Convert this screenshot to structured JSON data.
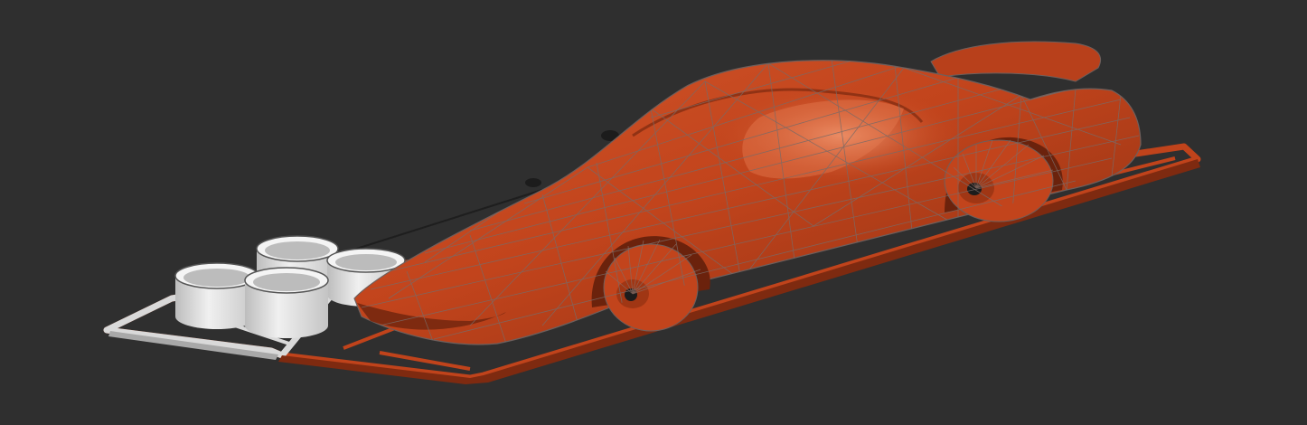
{
  "viewport": {
    "background_color": "#2f2f2f"
  },
  "scene": {
    "model": {
      "body_color": "#c2441c",
      "body_highlight_color": "#e8805a",
      "body_shadow_color": "#7e2a10",
      "wireframe_color": "#7a6a66"
    },
    "sprue_frame": {
      "color": "#c0431b",
      "light_section_color": "#d9d9d9"
    },
    "wheel_cups": {
      "count": 4,
      "color": "#e4e4e4",
      "shade_color": "#b8b8b8"
    }
  }
}
